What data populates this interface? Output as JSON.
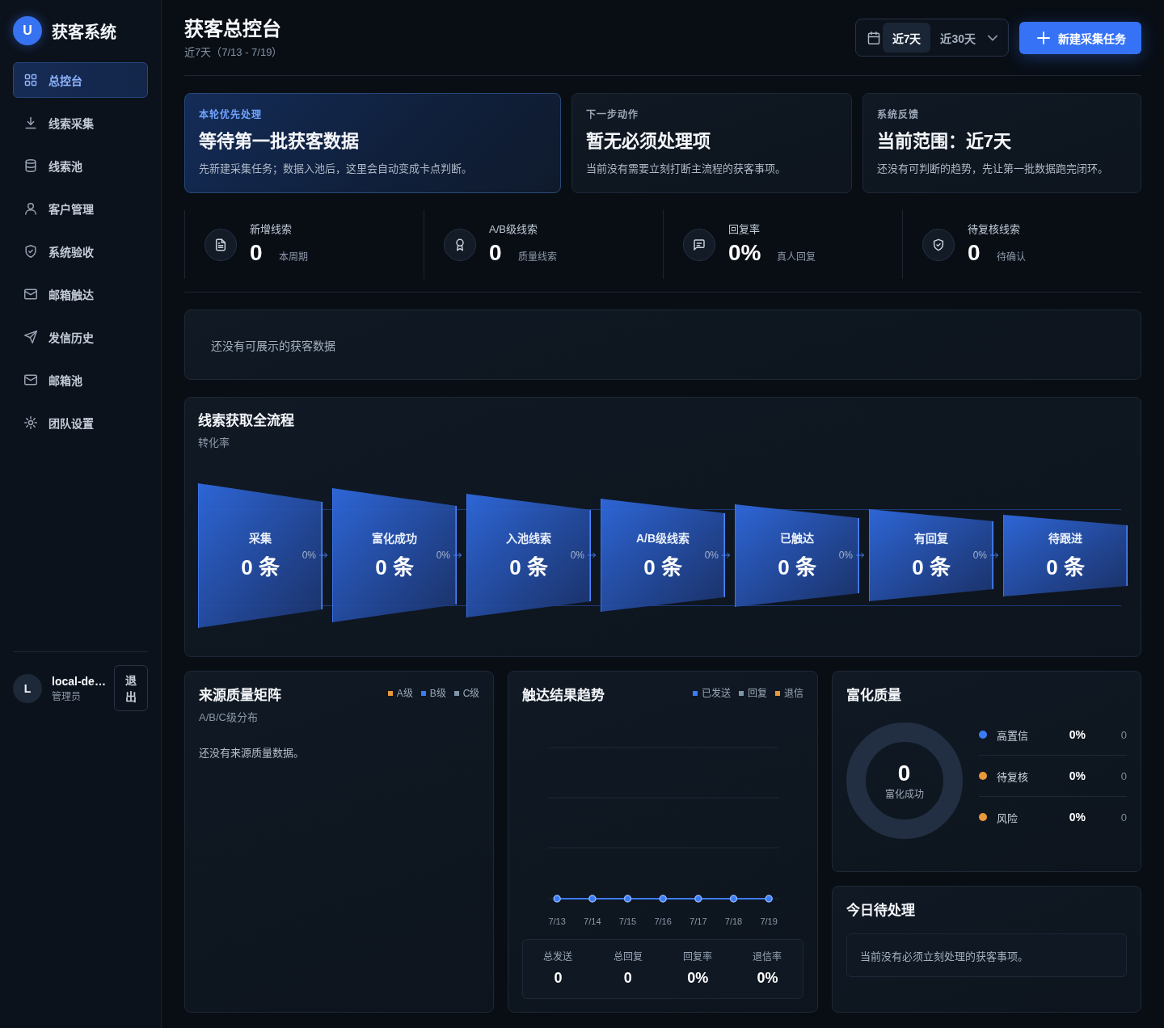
{
  "sidebar": {
    "logo_letter": "U",
    "brand": "获客系统",
    "nav": [
      {
        "label": "总控台",
        "selected": true
      },
      {
        "label": "线索采集",
        "selected": false
      },
      {
        "label": "线索池",
        "selected": false
      },
      {
        "label": "客户管理",
        "selected": false
      },
      {
        "label": "系统验收",
        "selected": false
      },
      {
        "label": "邮箱触达",
        "selected": false
      },
      {
        "label": "发信历史",
        "selected": false
      },
      {
        "label": "邮箱池",
        "selected": false
      },
      {
        "label": "团队设置",
        "selected": false
      }
    ],
    "user": {
      "initial": "L",
      "name": "local-de…",
      "role": "管理员",
      "logout": "退出"
    }
  },
  "header": {
    "title": "获客总控台",
    "subtitle": "近7天（7/13 - 7/19）",
    "range_options": [
      {
        "label": "近7天",
        "selected": true
      },
      {
        "label": "近30天",
        "selected": false
      }
    ],
    "new_task_button": "新建采集任务"
  },
  "focus_cards": [
    {
      "eyebrow": "本轮优先处理",
      "title": "等待第一批获客数据",
      "text": "先新建采集任务；数据入池后，这里会自动变成卡点判断。",
      "highlighted": true
    },
    {
      "eyebrow": "下一步动作",
      "title": "暂无必须处理项",
      "text": "当前没有需要立刻打断主流程的获客事项。",
      "highlighted": false
    },
    {
      "eyebrow": "系统反馈",
      "title": "当前范围：近7天",
      "text": "还没有可判断的趋势，先让第一批数据跑完闭环。",
      "highlighted": false
    }
  ],
  "kpis": [
    {
      "label": "新增线索",
      "value": "0",
      "note": "本周期"
    },
    {
      "label": "A/B级线索",
      "value": "0",
      "note": "质量线索"
    },
    {
      "label": "回复率",
      "value": "0%",
      "note": "真人回复"
    },
    {
      "label": "待复核线索",
      "value": "0",
      "note": "待确认"
    }
  ],
  "notice": "还没有可展示的获客数据",
  "funnel": {
    "title": "线索获取全流程",
    "subtitle": "转化率",
    "stages": [
      {
        "label": "采集",
        "count": "0 条",
        "rate": "0%"
      },
      {
        "label": "富化成功",
        "count": "0 条",
        "rate": "0%"
      },
      {
        "label": "入池线索",
        "count": "0 条",
        "rate": "0%"
      },
      {
        "label": "A/B级线索",
        "count": "0 条",
        "rate": "0%"
      },
      {
        "label": "已触达",
        "count": "0 条",
        "rate": "0%"
      },
      {
        "label": "有回复",
        "count": "0 条",
        "rate": "0%"
      },
      {
        "label": "待跟进",
        "count": "0 条"
      }
    ]
  },
  "source_quality": {
    "title": "来源质量矩阵",
    "subtitle": "A/B/C级分布",
    "legend": [
      {
        "label": "A级",
        "color": "#e8993a"
      },
      {
        "label": "B级",
        "color": "#3b7cf6"
      },
      {
        "label": "C级",
        "color": "#7f95aa"
      }
    ],
    "empty_text": "还没有来源质量数据。"
  },
  "outreach_trend": {
    "title": "触达结果趋势",
    "legend": [
      {
        "label": "已发送",
        "color": "#3b7cf6"
      },
      {
        "label": "回复",
        "color": "#7f95aa"
      },
      {
        "label": "退信",
        "color": "#e8993a"
      }
    ],
    "x_labels": [
      "7/13",
      "7/14",
      "7/15",
      "7/16",
      "7/17",
      "7/18",
      "7/19"
    ],
    "stats": [
      {
        "label": "总发送",
        "value": "0"
      },
      {
        "label": "总回复",
        "value": "0"
      },
      {
        "label": "回复率",
        "value": "0%"
      },
      {
        "label": "退信率",
        "value": "0%"
      }
    ]
  },
  "enrichment_quality": {
    "title": "富化质量",
    "center_value": "0",
    "center_label": "富化成功",
    "rows": [
      {
        "label": "高置信",
        "color": "#3b7cf6",
        "percent": "0%",
        "count": "0"
      },
      {
        "label": "待复核",
        "color": "#e8993a",
        "percent": "0%",
        "count": "0"
      },
      {
        "label": "风险",
        "color": "#e8993a",
        "percent": "0%",
        "count": "0"
      }
    ]
  },
  "today_tasks": {
    "title": "今日待处理",
    "empty_text": "当前没有必须立刻处理的获客事项。"
  }
}
